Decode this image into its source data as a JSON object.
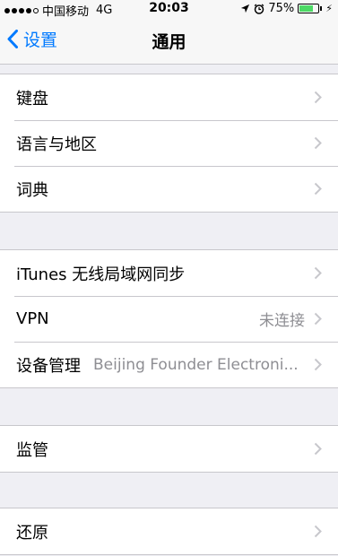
{
  "status_bar": {
    "carrier": "中国移动",
    "network": "4G",
    "time": "20:03",
    "battery": "75%",
    "battery_level": 0.75,
    "battery_color": "#4cd964"
  },
  "nav": {
    "back_label": "设置",
    "title": "通用",
    "accent_color": "#007aff"
  },
  "groups": [
    {
      "rows": [
        {
          "label": "键盘"
        },
        {
          "label": "语言与地区"
        },
        {
          "label": "词典"
        }
      ]
    },
    {
      "rows": [
        {
          "label": "iTunes 无线局域网同步"
        },
        {
          "label": "VPN",
          "value": "未连接"
        },
        {
          "label": "设备管理",
          "value": "Beijing Founder Electroni..."
        }
      ]
    },
    {
      "rows": [
        {
          "label": "监管"
        }
      ]
    },
    {
      "rows": [
        {
          "label": "还原"
        }
      ]
    }
  ],
  "icons": [
    "signal-dots",
    "location-arrow-icon",
    "alarm-clock-icon",
    "battery-icon",
    "charging-bolt-icon",
    "chevron-left-icon",
    "chevron-right-icon"
  ]
}
